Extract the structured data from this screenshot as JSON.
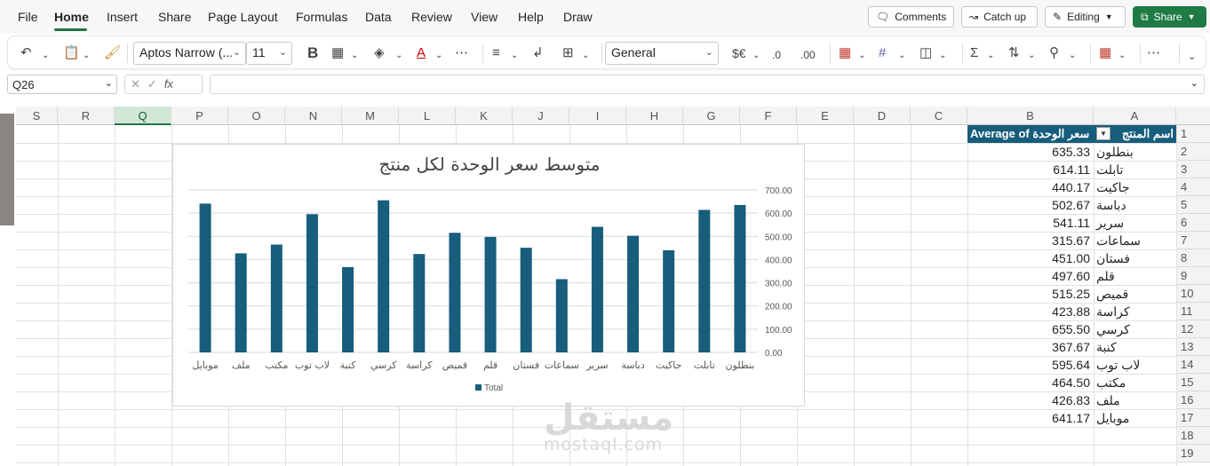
{
  "menu": {
    "items": [
      "File",
      "Home",
      "Insert",
      "Share",
      "Page Layout",
      "Formulas",
      "Data",
      "Review",
      "View",
      "Help",
      "Draw"
    ],
    "active": "Home"
  },
  "top_buttons": {
    "comments": "Comments",
    "catchup": "Catch up",
    "editing": "Editing",
    "share": "Share"
  },
  "ribbon": {
    "font_name": "Aptos Narrow (...",
    "font_size": "11",
    "bold": "B",
    "number_format": "General",
    "currency": "$€"
  },
  "formula_bar": {
    "name_box": "Q26",
    "formula": ""
  },
  "grid": {
    "columns": [
      "S",
      "R",
      "Q",
      "P",
      "O",
      "N",
      "M",
      "L",
      "K",
      "J",
      "I",
      "H",
      "G",
      "F",
      "E",
      "D",
      "C",
      "B",
      "A"
    ],
    "selected_column": "Q",
    "rows": [
      "1",
      "2",
      "3",
      "4",
      "5",
      "6",
      "7",
      "8",
      "9",
      "10",
      "11",
      "12",
      "13",
      "14",
      "15",
      "16",
      "17",
      "18",
      "19"
    ]
  },
  "pivot": {
    "header_product": "اسم المنتج",
    "header_value": "Average of سعر الوحدة",
    "rows": [
      {
        "product": "بنطلون",
        "value": "635.33"
      },
      {
        "product": "تابلت",
        "value": "614.11"
      },
      {
        "product": "جاكيت",
        "value": "440.17"
      },
      {
        "product": "دباسة",
        "value": "502.67"
      },
      {
        "product": "سرير",
        "value": "541.11"
      },
      {
        "product": "سماعات",
        "value": "315.67"
      },
      {
        "product": "فستان",
        "value": "451.00"
      },
      {
        "product": "قلم",
        "value": "497.60"
      },
      {
        "product": "قميص",
        "value": "515.25"
      },
      {
        "product": "كراسة",
        "value": "423.88"
      },
      {
        "product": "كرسي",
        "value": "655.50"
      },
      {
        "product": "كنبة",
        "value": "367.67"
      },
      {
        "product": "لاب توب",
        "value": "595.64"
      },
      {
        "product": "مكتب",
        "value": "464.50"
      },
      {
        "product": "ملف",
        "value": "426.83"
      },
      {
        "product": "موبايل",
        "value": "641.17"
      }
    ]
  },
  "chart_data": {
    "type": "bar",
    "title": "متوسط سعر الوحدة لكل منتج",
    "categories": [
      "بنطلون",
      "تابلت",
      "جاكيت",
      "دباسة",
      "سرير",
      "سماعات",
      "فستان",
      "قلم",
      "قميص",
      "كراسة",
      "كرسي",
      "كنبة",
      "لاب توب",
      "مكتب",
      "ملف",
      "موبايل"
    ],
    "series": [
      {
        "name": "Total",
        "values": [
          635.33,
          614.11,
          440.17,
          502.67,
          541.11,
          315.67,
          451.0,
          497.6,
          515.25,
          423.88,
          655.5,
          367.67,
          595.64,
          464.5,
          426.83,
          641.17
        ]
      }
    ],
    "y_ticks": [
      "0.00",
      "100.00",
      "200.00",
      "300.00",
      "400.00",
      "500.00",
      "600.00",
      "700.00"
    ],
    "ylim": [
      0,
      700
    ],
    "axis_position": "right",
    "x_direction": "right-to-left",
    "legend": "bottom",
    "grid": true,
    "bar_color": "#175d7c"
  },
  "watermark": {
    "arabic": "مستقل",
    "latin": "mostaql.com"
  },
  "colors": {
    "accent": "#217346",
    "pivot_header": "#175d7c"
  }
}
